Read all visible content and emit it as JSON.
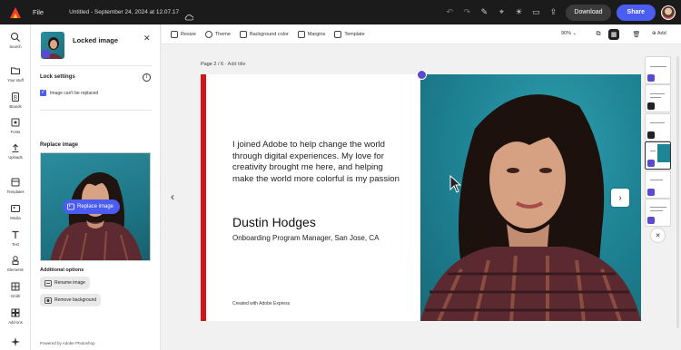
{
  "topbar": {
    "file_label": "File",
    "doc_title": "Untitled - September 24, 2024 at 12.07.17",
    "download_label": "Download",
    "share_label": "Share"
  },
  "rail": {
    "items": [
      {
        "label": "Search",
        "icon": "search-icon"
      },
      {
        "label": "Your stuff",
        "icon": "folder-icon"
      },
      {
        "label": "Brands",
        "icon": "brand-icon"
      },
      {
        "label": "Fonts",
        "icon": "font-icon"
      },
      {
        "label": "Uploads",
        "icon": "upload-icon"
      },
      {
        "label": "Templates",
        "icon": "templates-icon"
      },
      {
        "label": "Media",
        "icon": "media-icon"
      },
      {
        "label": "Text",
        "icon": "text-icon"
      },
      {
        "label": "Elements",
        "icon": "elements-icon"
      },
      {
        "label": "Grids",
        "icon": "grids-icon"
      },
      {
        "label": "Add-ons",
        "icon": "addons-icon"
      }
    ]
  },
  "panel": {
    "title": "Locked image",
    "lock_settings": "Lock settings",
    "lock_checkbox": "Image can't be replaced",
    "replace_title": "Replace image",
    "replace_button": "Replace image",
    "additional_title": "Additional options",
    "rename_button": "Rename image",
    "remove_bg_button": "Remove background",
    "powered_by": "Powered by Adobe Photoshop"
  },
  "canvas_toolbar": {
    "items": [
      "Resize",
      "Theme",
      "Background color",
      "Margins",
      "Template"
    ],
    "zoom": "90%",
    "add_label": "Add"
  },
  "canvas": {
    "page_label": "Page 2 / 6",
    "add_title": "Add title",
    "quote": "I joined Adobe to help change the world through digital experiences. My love for creativity brought me here, and helping make the world more colorful is my passion",
    "name": "Dustin Hodges",
    "role": "Onboarding Program Manager, San Jose, CA",
    "created_with": "Created with Adobe Express"
  },
  "colors": {
    "accent": "#4b5cf0",
    "red_bar": "#d3141b",
    "teal_bg": "#1f8596"
  }
}
